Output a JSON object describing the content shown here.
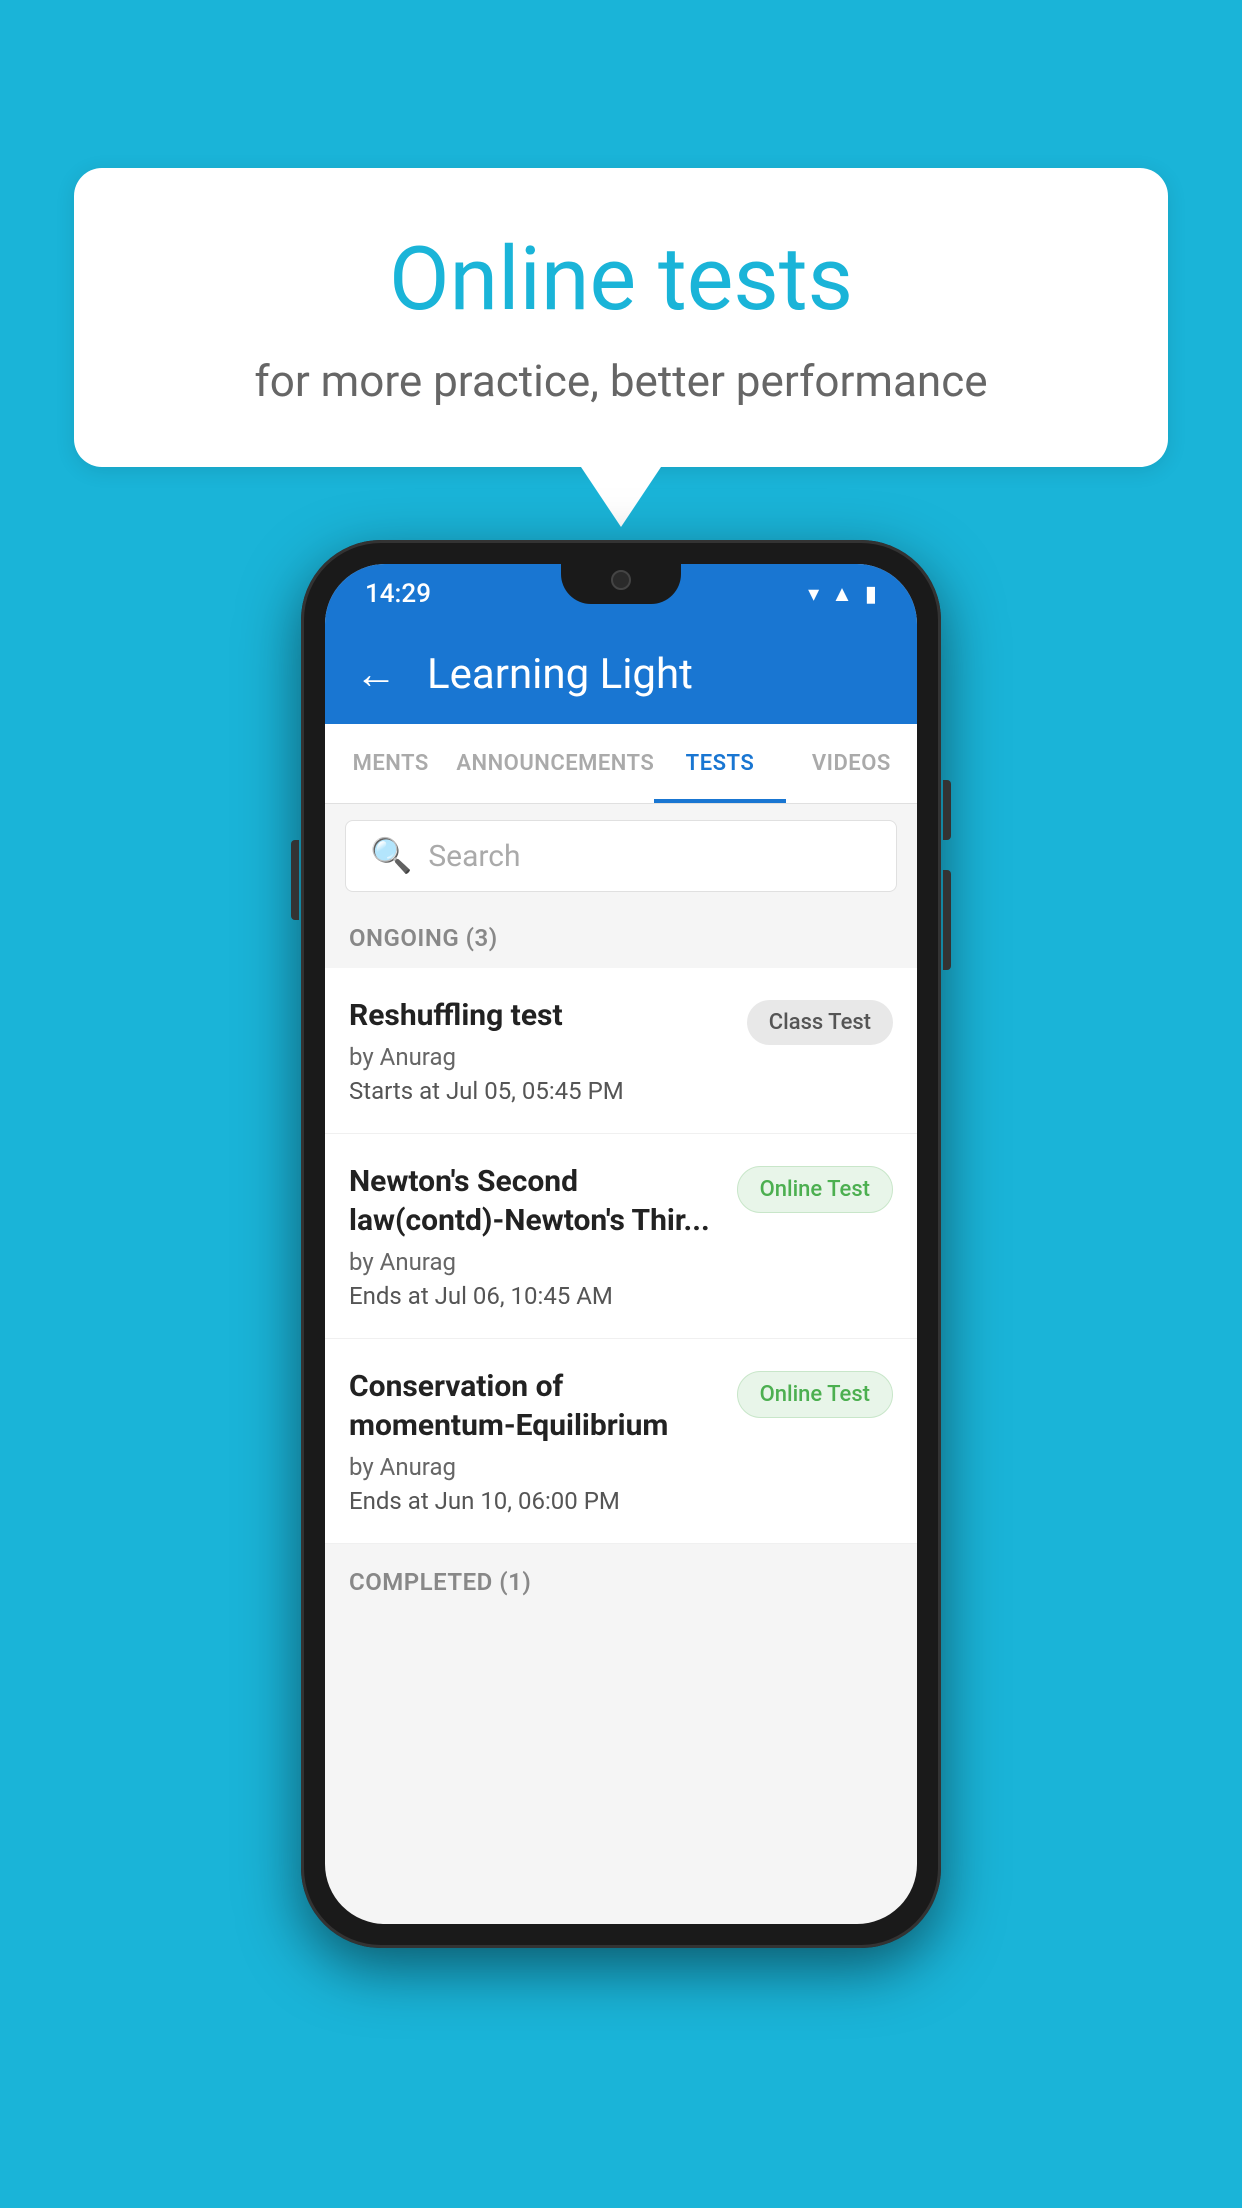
{
  "background_color": "#1ab4d8",
  "speech_bubble": {
    "title": "Online tests",
    "subtitle": "for more practice, better performance"
  },
  "phone": {
    "status_bar": {
      "time": "14:29",
      "icons": [
        "wifi",
        "signal",
        "battery"
      ]
    },
    "header": {
      "back_label": "←",
      "title": "Learning Light"
    },
    "tabs": [
      {
        "label": "MENTS",
        "active": false
      },
      {
        "label": "ANNOUNCEMENTS",
        "active": false
      },
      {
        "label": "TESTS",
        "active": true
      },
      {
        "label": "VIDEOS",
        "active": false
      }
    ],
    "search": {
      "placeholder": "Search"
    },
    "ongoing_section": {
      "label": "ONGOING (3)"
    },
    "tests": [
      {
        "title": "Reshuffling test",
        "author": "by Anurag",
        "time_label": "Starts at",
        "time": "Jul 05, 05:45 PM",
        "badge": "Class Test",
        "badge_type": "class"
      },
      {
        "title": "Newton's Second law(contd)-Newton's Thir...",
        "author": "by Anurag",
        "time_label": "Ends at",
        "time": "Jul 06, 10:45 AM",
        "badge": "Online Test",
        "badge_type": "online"
      },
      {
        "title": "Conservation of momentum-Equilibrium",
        "author": "by Anurag",
        "time_label": "Ends at",
        "time": "Jun 10, 06:00 PM",
        "badge": "Online Test",
        "badge_type": "online"
      }
    ],
    "completed_section": {
      "label": "COMPLETED (1)"
    }
  }
}
